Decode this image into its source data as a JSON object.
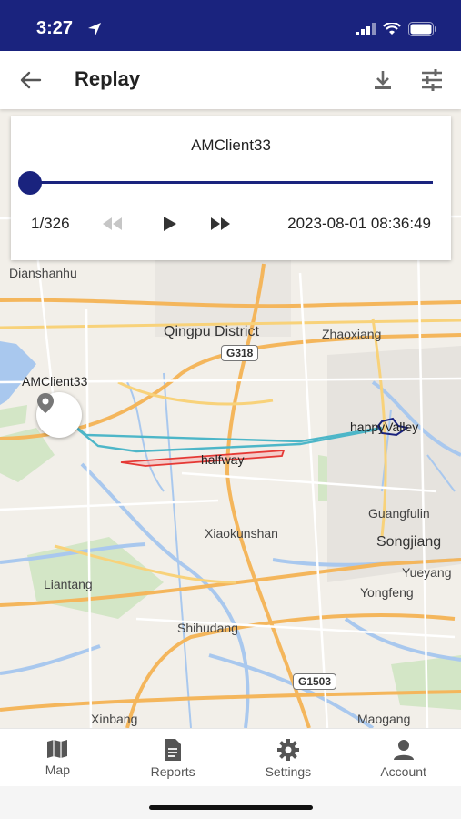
{
  "status": {
    "time": "3:27",
    "icons": [
      "location-arrow-icon",
      "signal-icon",
      "wifi-icon",
      "battery-icon"
    ]
  },
  "app_bar": {
    "title": "Replay",
    "icons": [
      "back-arrow-icon",
      "download-icon",
      "filter-icon"
    ]
  },
  "replay": {
    "device": "AMClient33",
    "counter": "1/326",
    "timestamp": "2023-08-01 08:36:49",
    "progress": 0,
    "icons": [
      "rewind-icon",
      "play-icon",
      "fast-forward-icon"
    ]
  },
  "map": {
    "marker_label": "AMClient33",
    "places": {
      "dianshanhu": "Dianshanhu",
      "qingpu": "Qingpu District",
      "zhaoxiang": "Zhaoxiang",
      "xiaokunshan": "Xiaokunshan",
      "guangfulin": "Guangfulin",
      "songjiang": "Songjiang",
      "liantang": "Liantang",
      "yueyang": "Yueyang",
      "yongfeng": "Yongfeng",
      "shihudang": "Shihudang",
      "xinbang": "Xinbang",
      "maogang": "Maogang"
    },
    "roads": {
      "g318": "G318",
      "g1503": "G1503"
    },
    "geofences": {
      "happy_valley": "happyValley",
      "halfway": "halfway"
    },
    "colors": {
      "route": "#4db6c8",
      "halfway_fence": "#e53935",
      "happy_valley_fence": "#1a237e",
      "accent": "#1a237e"
    }
  },
  "nav": {
    "items": [
      {
        "label": "Map",
        "icon": "map-icon"
      },
      {
        "label": "Reports",
        "icon": "reports-icon"
      },
      {
        "label": "Settings",
        "icon": "settings-gear-icon"
      },
      {
        "label": "Account",
        "icon": "account-icon"
      }
    ]
  }
}
